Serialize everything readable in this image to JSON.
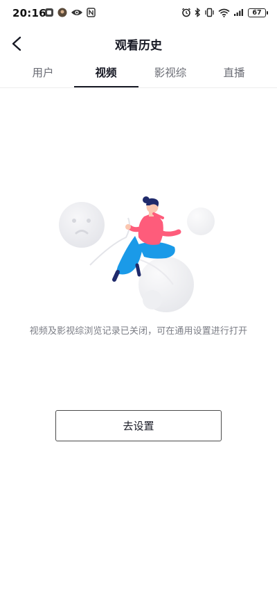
{
  "status_bar": {
    "time": "20:16",
    "battery": "67",
    "left_icons": [
      "app-notification-icon",
      "avatar-notification-icon",
      "eye-icon",
      "nfc-icon"
    ],
    "right_icons": [
      "alarm-icon",
      "bluetooth-icon",
      "vibrate-icon",
      "wifi-icon",
      "signal-icon",
      "battery-icon"
    ]
  },
  "header": {
    "title": "观看历史",
    "back_icon": "chevron-left-icon"
  },
  "tabs": [
    {
      "label": "用户",
      "active": false
    },
    {
      "label": "视频",
      "active": true
    },
    {
      "label": "影视综",
      "active": false
    },
    {
      "label": "直播",
      "active": false
    }
  ],
  "empty_state": {
    "illustration": "woman-sitting-on-bubble-illustration",
    "message": "视频及影视综浏览记录已关闭，可在通用设置进行打开",
    "button_label": "去设置"
  },
  "colors": {
    "text_primary": "#161823",
    "text_secondary": "#7b7d85",
    "accent_pink": "#fe5c7b",
    "accent_blue": "#1a9ae8",
    "navy": "#1f2a6b"
  }
}
